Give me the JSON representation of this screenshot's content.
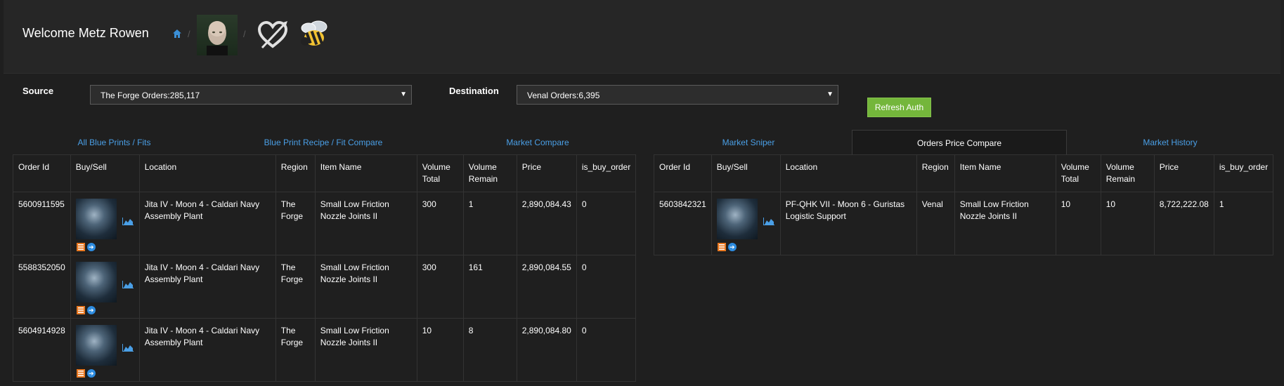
{
  "header": {
    "welcome": "Welcome Metz Rowen",
    "breadcrumb_separator": "/"
  },
  "filters": {
    "source_label": "Source",
    "source_value": "The Forge Orders:285,117",
    "destination_label": "Destination",
    "destination_value": "Venal Orders:6,395",
    "refresh_label": "Refresh Auth"
  },
  "tabs": [
    {
      "label": "All Blue Prints / Fits"
    },
    {
      "label": "Blue Print Recipe / Fit Compare"
    },
    {
      "label": "Market Compare"
    },
    {
      "label": "Market Sniper"
    },
    {
      "label": "Orders Price Compare"
    },
    {
      "label": "Market History"
    }
  ],
  "columns": [
    "Order Id",
    "Buy/Sell",
    "Location",
    "Region",
    "Item Name",
    "Volume Total",
    "Volume Remain",
    "Price",
    "is_buy_order"
  ],
  "source_orders": [
    {
      "order_id": "5600911595",
      "location": "Jita IV - Moon 4 - Caldari Navy Assembly Plant",
      "region": "The Forge",
      "item": "Small Low Friction Nozzle Joints II",
      "volume_total": "300",
      "volume_remain": "1",
      "price": "2,890,084.43",
      "is_buy_order": "0"
    },
    {
      "order_id": "5588352050",
      "location": "Jita IV - Moon 4 - Caldari Navy Assembly Plant",
      "region": "The Forge",
      "item": "Small Low Friction Nozzle Joints II",
      "volume_total": "300",
      "volume_remain": "161",
      "price": "2,890,084.55",
      "is_buy_order": "0"
    },
    {
      "order_id": "5604914928",
      "location": "Jita IV - Moon 4 - Caldari Navy Assembly Plant",
      "region": "The Forge",
      "item": "Small Low Friction Nozzle Joints II",
      "volume_total": "10",
      "volume_remain": "8",
      "price": "2,890,084.80",
      "is_buy_order": "0"
    }
  ],
  "destination_orders": [
    {
      "order_id": "5603842321",
      "location": "PF-QHK VII - Moon 6 - Guristas Logistic Support",
      "region": "Venal",
      "item": "Small Low Friction Nozzle Joints II",
      "volume_total": "10",
      "volume_remain": "10",
      "price": "8,722,222.08",
      "is_buy_order": "1"
    }
  ],
  "icons": {
    "home": "home-icon",
    "heart": "crossed-heart-icon",
    "bee": "bee-icon",
    "history": "chart-area-icon",
    "details": "list-icon",
    "open": "arrow-circle-icon"
  },
  "colors": {
    "background": "#1f1f1f",
    "link": "#4a9fe6",
    "button": "#74b63b",
    "orange": "#e8771f"
  }
}
